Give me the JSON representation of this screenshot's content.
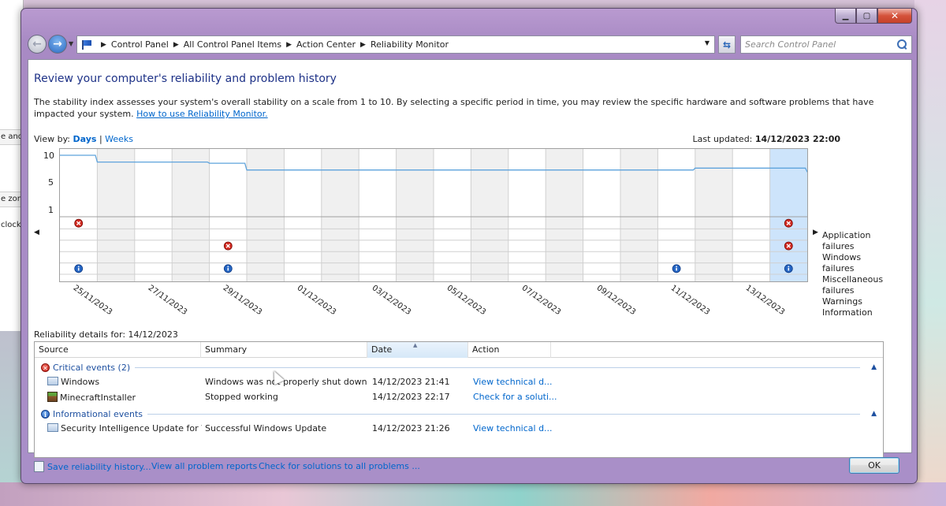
{
  "background": {
    "left_fragments": [
      "e and",
      "e zon",
      "clock"
    ]
  },
  "address_bar": {
    "crumbs": [
      "Control Panel",
      "All Control Panel Items",
      "Action Center",
      "Reliability Monitor"
    ],
    "search_placeholder": "Search Control Panel"
  },
  "page": {
    "title": "Review your computer's reliability and problem history",
    "description": "The stability index assesses your system's overall stability on a scale from 1 to 10. By selecting a specific period in time, you may review the specific hardware and software problems that have impacted your system.",
    "help_link": "How to use Reliability Monitor.",
    "view_by_label": "View by:",
    "view_days": "Days",
    "view_separator": "|",
    "view_weeks": "Weeks",
    "last_updated_label": "Last updated:",
    "last_updated_value": "14/12/2023 22:00"
  },
  "chart": {
    "y_ticks": [
      "10",
      "5",
      "1"
    ],
    "row_labels": [
      "Application failures",
      "Windows failures",
      "Miscellaneous failures",
      "Warnings",
      "Information"
    ],
    "date_labels": [
      "25/11/2023",
      "27/11/2023",
      "29/11/2023",
      "01/12/2023",
      "03/12/2023",
      "05/12/2023",
      "07/12/2023",
      "09/12/2023",
      "11/12/2023",
      "13/12/2023"
    ],
    "selected_day_index": 19,
    "stability_index": [
      10,
      8.9,
      8.9,
      8.9,
      8.7,
      7.6,
      7.6,
      7.6,
      7.6,
      7.6,
      7.6,
      7.6,
      7.6,
      7.6,
      7.6,
      7.6,
      7.6,
      7.9,
      7.9,
      7.9,
      7.3
    ],
    "events": [
      {
        "day": 0,
        "row": 0,
        "type": "error"
      },
      {
        "day": 0,
        "row": 4,
        "type": "info"
      },
      {
        "day": 4,
        "row": 2,
        "type": "error"
      },
      {
        "day": 4,
        "row": 4,
        "type": "info"
      },
      {
        "day": 16,
        "row": 4,
        "type": "info"
      },
      {
        "day": 19,
        "row": 0,
        "type": "error"
      },
      {
        "day": 19,
        "row": 2,
        "type": "error"
      },
      {
        "day": 19,
        "row": 4,
        "type": "info"
      }
    ]
  },
  "details": {
    "label": "Reliability details for: 14/12/2023",
    "columns": [
      "Source",
      "Summary",
      "Date",
      "Action"
    ],
    "groups": [
      {
        "label": "Critical events (2)",
        "type": "error",
        "rows": [
          {
            "source": "Windows",
            "summary": "Windows was not properly shut down",
            "date": "14/12/2023 21:41",
            "action": "View  technical d...",
            "icon": "app"
          },
          {
            "source": "MinecraftInstaller",
            "summary": "Stopped working",
            "date": "14/12/2023 22:17",
            "action": "Check for a soluti...",
            "icon": "minecraft"
          }
        ]
      },
      {
        "label": "Informational events",
        "type": "info",
        "rows": [
          {
            "source": "Security Intelligence Update for W...",
            "summary": "Successful Windows Update",
            "date": "14/12/2023 21:26",
            "action": "View  technical d...",
            "icon": "app"
          }
        ]
      }
    ]
  },
  "footer": {
    "save_link": "Save reliability history...",
    "view_all_link": "View all problem reports",
    "check_link": "Check for solutions to all problems ...",
    "ok_label": "OK"
  }
}
